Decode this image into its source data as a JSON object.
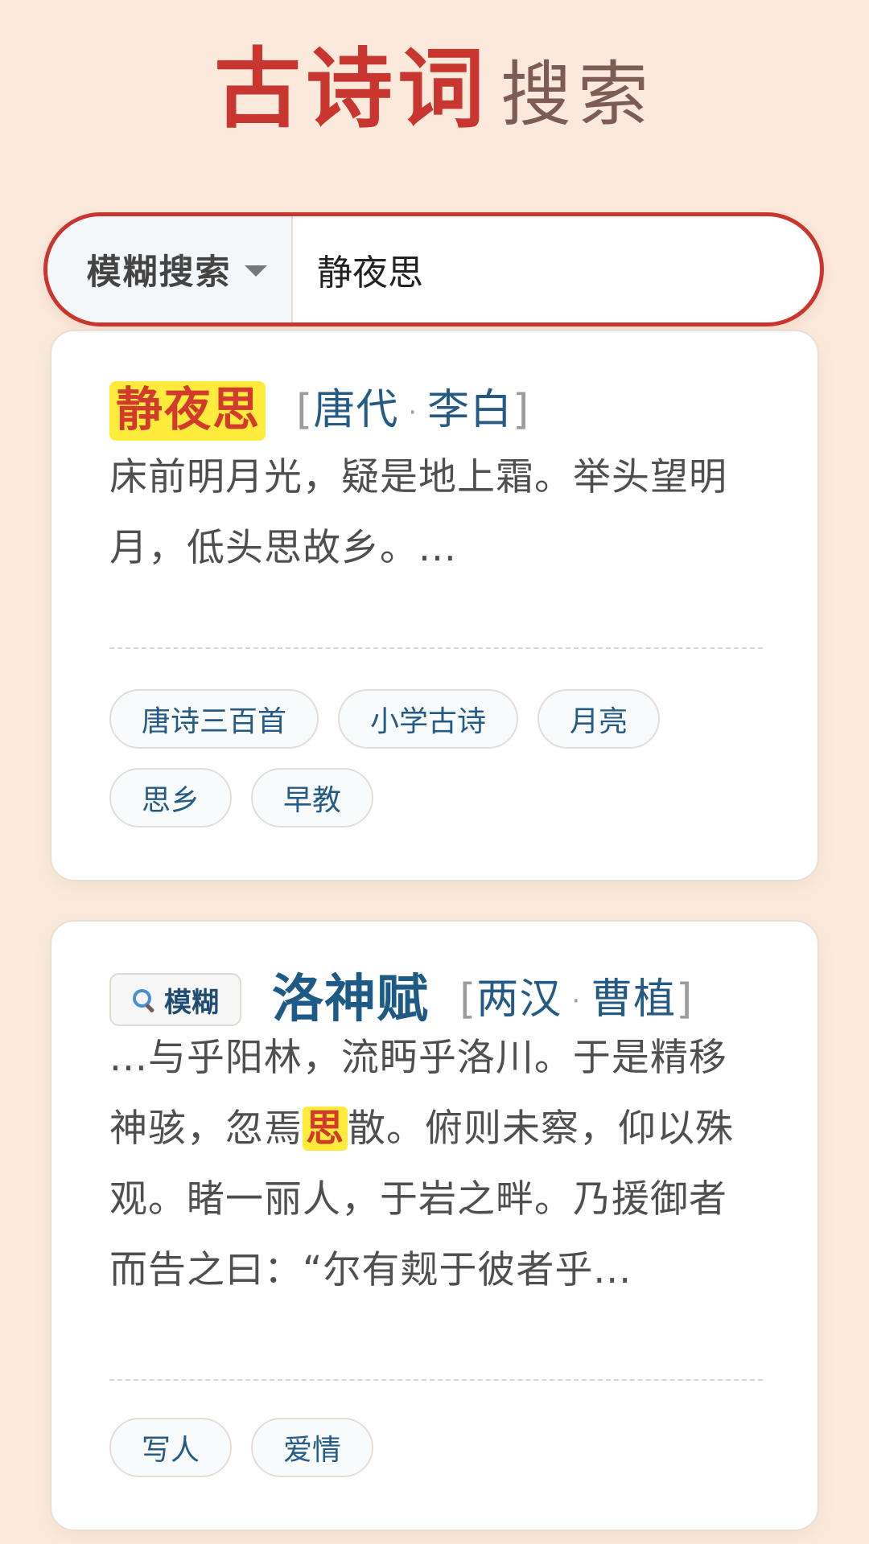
{
  "header": {
    "title_main": "古诗词",
    "title_sub": "搜索"
  },
  "search": {
    "mode_label": "模糊搜索",
    "query": "静夜思",
    "icon": "chevron-down-icon"
  },
  "results": [
    {
      "title": "静夜思",
      "dynasty": "唐代",
      "author": "李白",
      "excerpt": "床前明月光，疑是地上霜。举头望明月，低头思故乡。...",
      "tags": [
        "唐诗三百首",
        "小学古诗",
        "月亮",
        "思乡",
        "早教"
      ]
    },
    {
      "badge_label": "模糊",
      "badge_icon": "magnifier-icon",
      "title": "洛神赋",
      "dynasty": "两汉",
      "author": "曹植",
      "excerpt_before": "...与乎阳林，流眄乎洛川。于是精移神骇，忽焉",
      "excerpt_highlight": "思",
      "excerpt_after": "散。俯则未察，仰以殊观。睹一丽人，于岩之畔。乃援御者而告之曰：“尔有觌于彼者乎...",
      "tags": [
        "写人",
        "爱情"
      ]
    }
  ],
  "colors": {
    "background": "#fbeadb",
    "accent_red": "#c8362f",
    "highlight_yellow": "#ffeb3b",
    "link_blue": "#245a84"
  }
}
